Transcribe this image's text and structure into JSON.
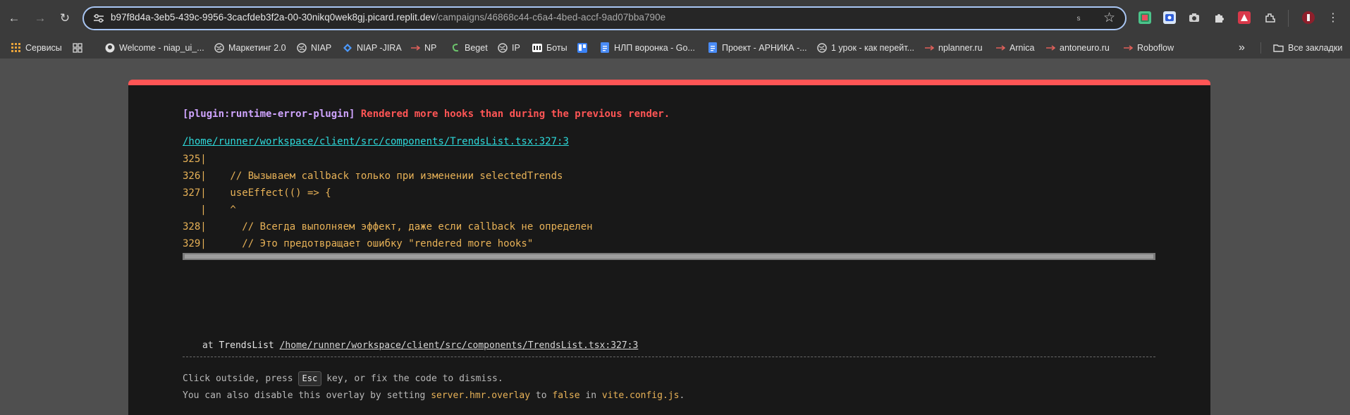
{
  "browser": {
    "url_host": "b97f8d4a-3eb5-439c-9956-3cacfdeb3f2a-00-30nikq0wek8gj.picard.replit.dev",
    "url_path": "/campaigns/46868c44-c6a4-4bed-accf-9ad07bba790e",
    "omnibox_badge": "s"
  },
  "bookmarks": [
    {
      "label": "Сервисы",
      "icon": "apps-grid-icon",
      "color": "#e8a33b"
    },
    {
      "label": "",
      "icon": "grid-icon",
      "color": "#cfcfcf"
    },
    {
      "label": "Welcome - niap_ui_...",
      "icon": "github-icon",
      "color": "#e0e0e0"
    },
    {
      "label": "Маркетинг 2.0",
      "icon": "globe-icon",
      "color": "#cfcfcf"
    },
    {
      "label": "NIAP",
      "icon": "globe-icon",
      "color": "#cfcfcf"
    },
    {
      "label": "NIAP -JIRA",
      "icon": "jira-icon",
      "color": "#4c9aff"
    },
    {
      "label": "NP",
      "icon": "link-icon",
      "color": "#e0605a"
    },
    {
      "label": "Beget",
      "icon": "beget-icon",
      "color": "#6cc36c"
    },
    {
      "label": "IP",
      "icon": "globe-icon",
      "color": "#cfcfcf"
    },
    {
      "label": "Боты",
      "icon": "bots-icon",
      "color": "#ffffff"
    },
    {
      "label": "",
      "icon": "trello-icon",
      "color": "#3b82f6"
    },
    {
      "label": "НЛП воронка - Go...",
      "icon": "docs-icon",
      "color": "#4a8cf7"
    },
    {
      "label": "Проект - АРНИКА -...",
      "icon": "docs-icon",
      "color": "#4a8cf7"
    },
    {
      "label": "1 урок - как перейт...",
      "icon": "globe-icon",
      "color": "#cfcfcf"
    },
    {
      "label": "nplanner.ru",
      "icon": "link-icon",
      "color": "#e0605a"
    },
    {
      "label": "Arnica",
      "icon": "link-icon",
      "color": "#e0605a"
    },
    {
      "label": "antoneuro.ru",
      "icon": "link-icon",
      "color": "#e0605a"
    },
    {
      "label": "Roboflow",
      "icon": "link-icon",
      "color": "#e0605a"
    }
  ],
  "bookmarks_more": "»",
  "all_bookmarks": "Все закладки",
  "overlay": {
    "plugin": "[plugin:runtime-error-plugin]",
    "message": "Rendered more hooks than during the previous render.",
    "file": "/home/runner/workspace/client/src/components/TrendsList.tsx:327:3",
    "frame_lines": [
      "325|",
      "326|    // Вызываем callback только при изменении selectedTrends",
      "327|    useEffect(() => {",
      "   |    ^",
      "328|      // Всегда выполняем эффект, даже если callback не определен",
      "329|      // Это предотвращает ошибку \"rendered more hooks\""
    ],
    "stack_prefix": "at",
    "stack_fn": "TrendsList",
    "stack_location": "/home/runner/workspace/client/src/components/TrendsList.tsx:327:3",
    "tip1_before": "Click outside, press",
    "tip1_key": "Esc",
    "tip1_after": "key, or fix the code to dismiss.",
    "tip2_a": "You can also disable this overlay by setting",
    "tip2_code1": "server.hmr.overlay",
    "tip2_b": "to",
    "tip2_code2": "false",
    "tip2_c": "in",
    "tip2_code3": "vite.config.js",
    "tip2_d": "."
  },
  "colors": {
    "error_red": "#ff5555",
    "plugin_purple": "#cfa4ff",
    "file_cyan": "#2dd9da",
    "code_yellow": "#e8b257"
  }
}
